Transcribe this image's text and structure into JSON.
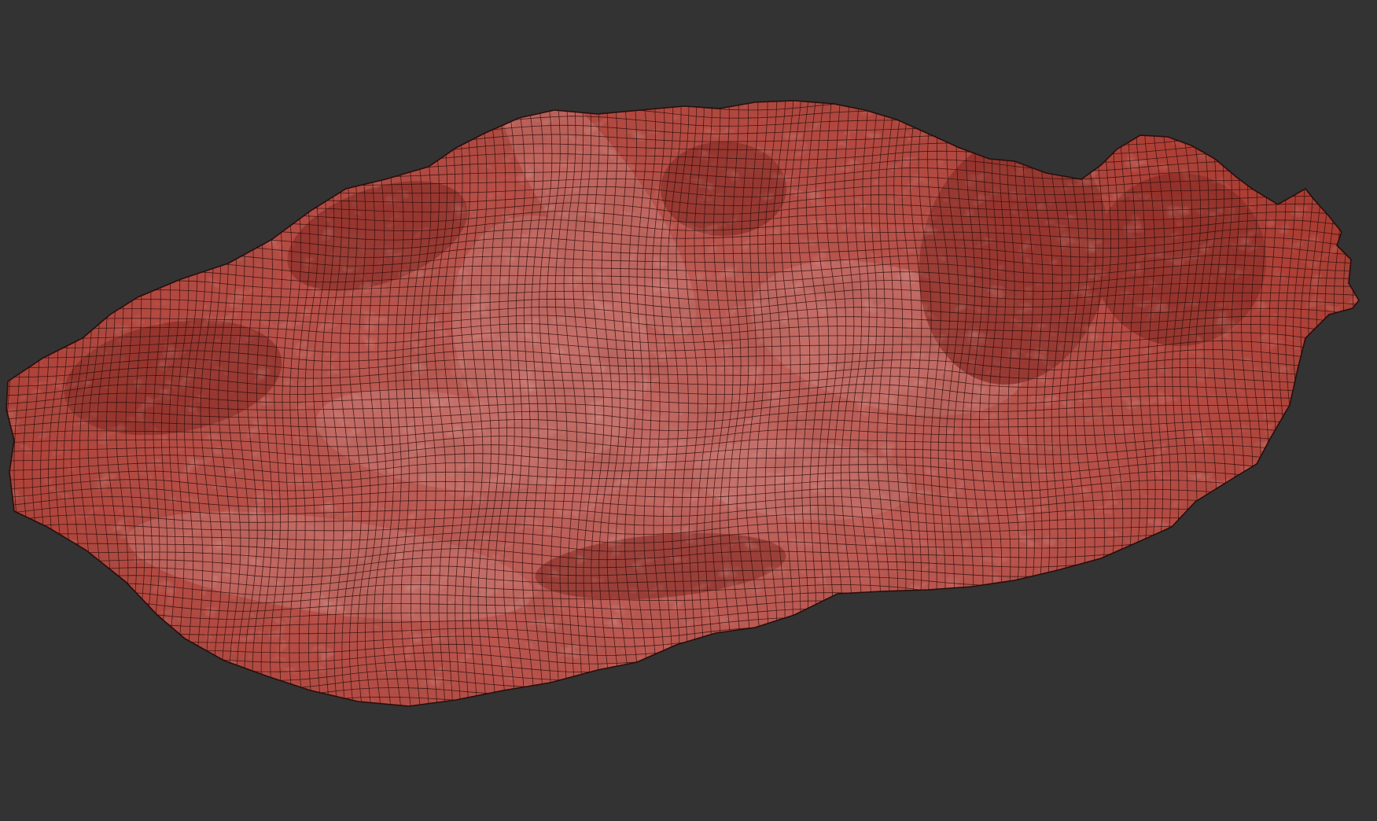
{
  "viewport": {
    "background_color": "#333333"
  },
  "mesh": {
    "object": "terrain-mesh",
    "display_mode": "shaded-with-wireframe",
    "surface_color": "#b5433a",
    "surface_highlight_color": "#c97a76",
    "surface_shadow_color": "#7e2620",
    "wire_color": "#2a0d0b"
  }
}
